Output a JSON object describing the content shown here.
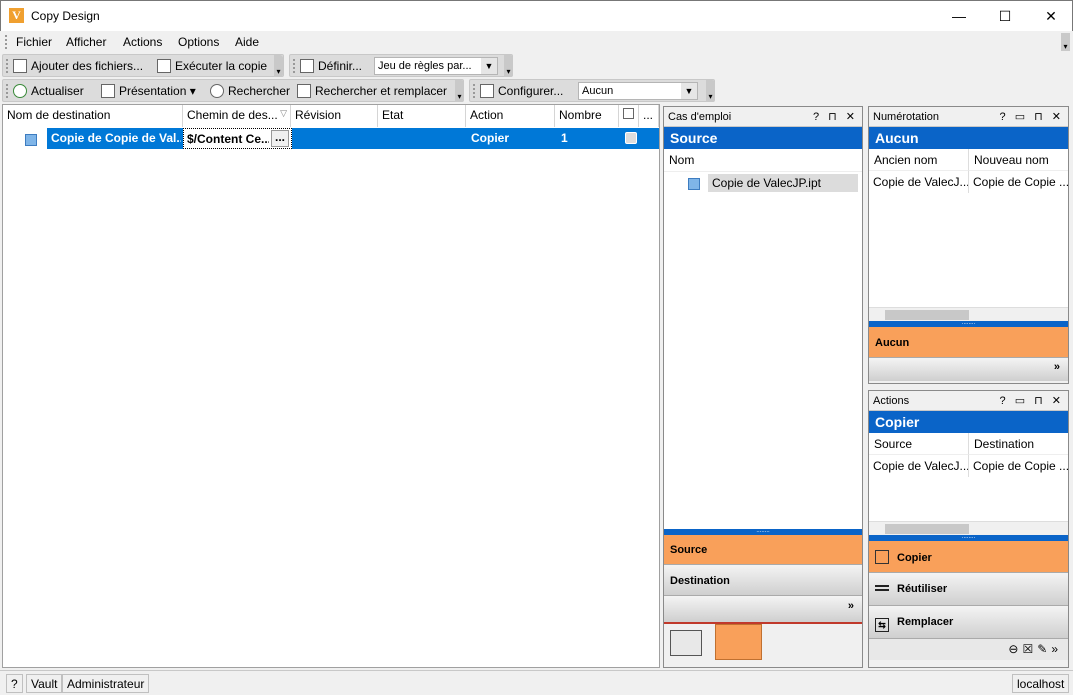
{
  "window": {
    "title": "Copy Design",
    "logo_letter": "V",
    "min": "—",
    "max": "☐",
    "close": "✕"
  },
  "menu": [
    "Fichier",
    "Afficher",
    "Actions",
    "Options",
    "Aide"
  ],
  "toolbar1": {
    "add_files": "Ajouter des fichiers...",
    "run_copy": "Exécuter la copie",
    "define": "Définir...",
    "ruleset": "Jeu de règles par..."
  },
  "toolbar2": {
    "refresh": "Actualiser",
    "presentation": "Présentation",
    "search": "Rechercher",
    "search_replace": "Rechercher et remplacer",
    "configure": "Configurer...",
    "config_value": "Aucun"
  },
  "grid": {
    "columns": [
      "Nom de destination",
      "Chemin de des...",
      "Révision",
      "Etat",
      "Action",
      "Nombre",
      "",
      "..."
    ],
    "rows": [
      {
        "name": "Copie de Copie de Val...",
        "path": "$/Content Ce...",
        "path_btn": "...",
        "revision": "",
        "state": "",
        "action": "Copier",
        "count": "1"
      }
    ]
  },
  "cas": {
    "title": "Cas d'emploi",
    "btns": "? ⊓ ✕",
    "header": "Source",
    "col": "Nom",
    "item": "Copie de ValecJP.ipt",
    "source_btn": "Source",
    "dest_btn": "Destination",
    "more": "»"
  },
  "num": {
    "title": "Numérotation",
    "btns": "? ▭ ⊓ ✕",
    "header": "Aucun",
    "col1": "Ancien nom",
    "col2": "Nouveau nom",
    "cell1": "Copie de ValecJ...",
    "cell2": "Copie de Copie ...",
    "orange_label": "Aucun",
    "more": "»"
  },
  "actions": {
    "title": "Actions",
    "btns": "? ▭ ⊓ ✕",
    "header": "Copier",
    "col1": "Source",
    "col2": "Destination",
    "cell1": "Copie de ValecJ...",
    "cell2": "Copie de Copie ...",
    "copy": "Copier",
    "reuse": "Réutiliser",
    "replace": "Remplacer"
  },
  "status": {
    "help": "?",
    "vault": "Vault",
    "user": "Administrateur",
    "server": "localhost"
  }
}
